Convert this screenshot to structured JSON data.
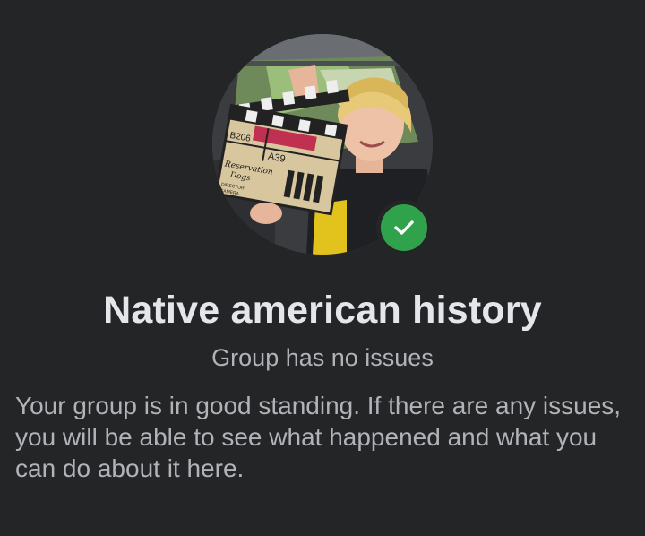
{
  "group": {
    "name": "Native american history",
    "status": "Group has no issues",
    "description": "Your group is in good standing. If there are any issues, you will be able to see what happened and what you can do about it here."
  },
  "avatar": {
    "icon": "profile-photo",
    "clapperboard_lines": [
      "B206",
      "A39",
      "Reservation",
      "Dogs",
      "DIRECTOR",
      "CAMERA"
    ]
  },
  "badge": {
    "icon": "checkmark-icon",
    "color": "#31a24c"
  },
  "colors": {
    "background": "#242526",
    "title": "#e4e6eb",
    "secondary_text": "#b0b3b8"
  }
}
